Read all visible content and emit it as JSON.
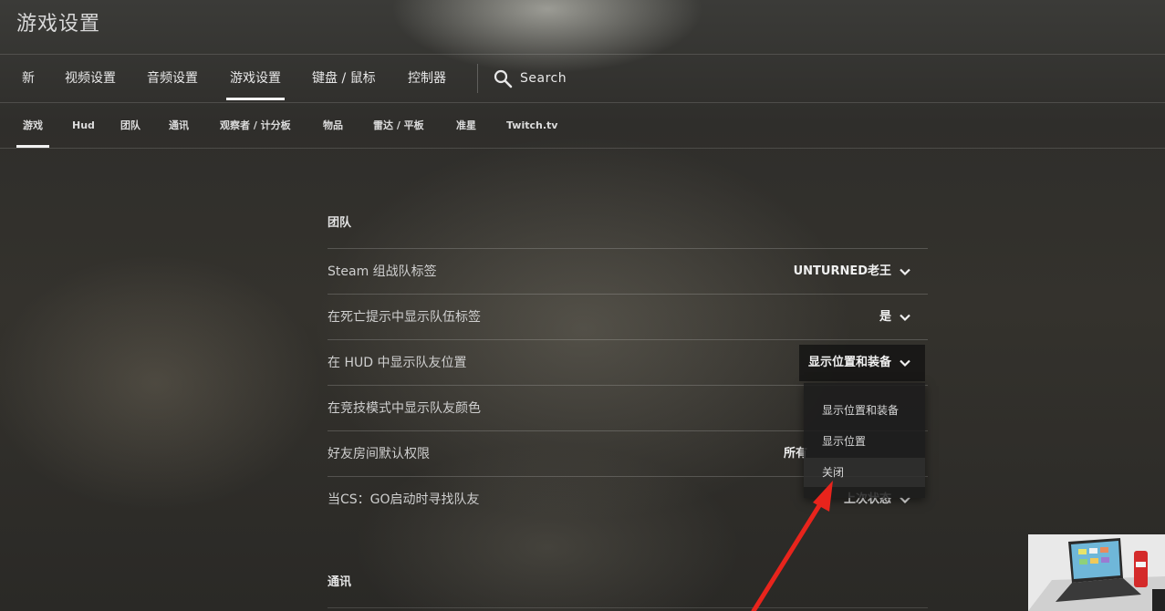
{
  "page": {
    "title": "游戏设置"
  },
  "tabs": [
    {
      "label": "新",
      "active": false
    },
    {
      "label": "视频设置",
      "active": false
    },
    {
      "label": "音频设置",
      "active": false
    },
    {
      "label": "游戏设置",
      "active": true
    },
    {
      "label": "键盘 / 鼠标",
      "active": false
    },
    {
      "label": "控制器",
      "active": false
    }
  ],
  "search": {
    "label": "Search",
    "icon": "search-icon"
  },
  "subtabs": [
    {
      "label": "游戏",
      "active": true
    },
    {
      "label": "Hud",
      "active": false
    },
    {
      "label": "团队",
      "active": false
    },
    {
      "label": "通讯",
      "active": false
    },
    {
      "label": "观察者 / 计分板",
      "active": false
    },
    {
      "label": "物品",
      "active": false
    },
    {
      "label": "雷达 / 平板",
      "active": false
    },
    {
      "label": "准星",
      "active": false
    },
    {
      "label": "Twitch.tv",
      "active": false
    }
  ],
  "team_section": {
    "title": "团队",
    "rows": [
      {
        "label": "Steam 组战队标签",
        "value": "UNTURNED老王"
      },
      {
        "label": "在死亡提示中显示队伍标签",
        "value": "是"
      },
      {
        "label": "在 HUD 中显示队友位置",
        "value": "显示位置和装备"
      },
      {
        "label": "在竞技模式中显示队友颜色",
        "value": ""
      },
      {
        "label": "好友房间默认权限",
        "value": "所有"
      },
      {
        "label": "当CS：GO启动时寻找队友",
        "value": "上次状态"
      }
    ]
  },
  "dropdown": {
    "options": [
      "显示位置和装备",
      "显示位置",
      "关闭"
    ],
    "hovered": "关闭"
  },
  "comms_section": {
    "title": "通讯"
  },
  "colors": {
    "annotation_arrow": "#e8241c"
  }
}
